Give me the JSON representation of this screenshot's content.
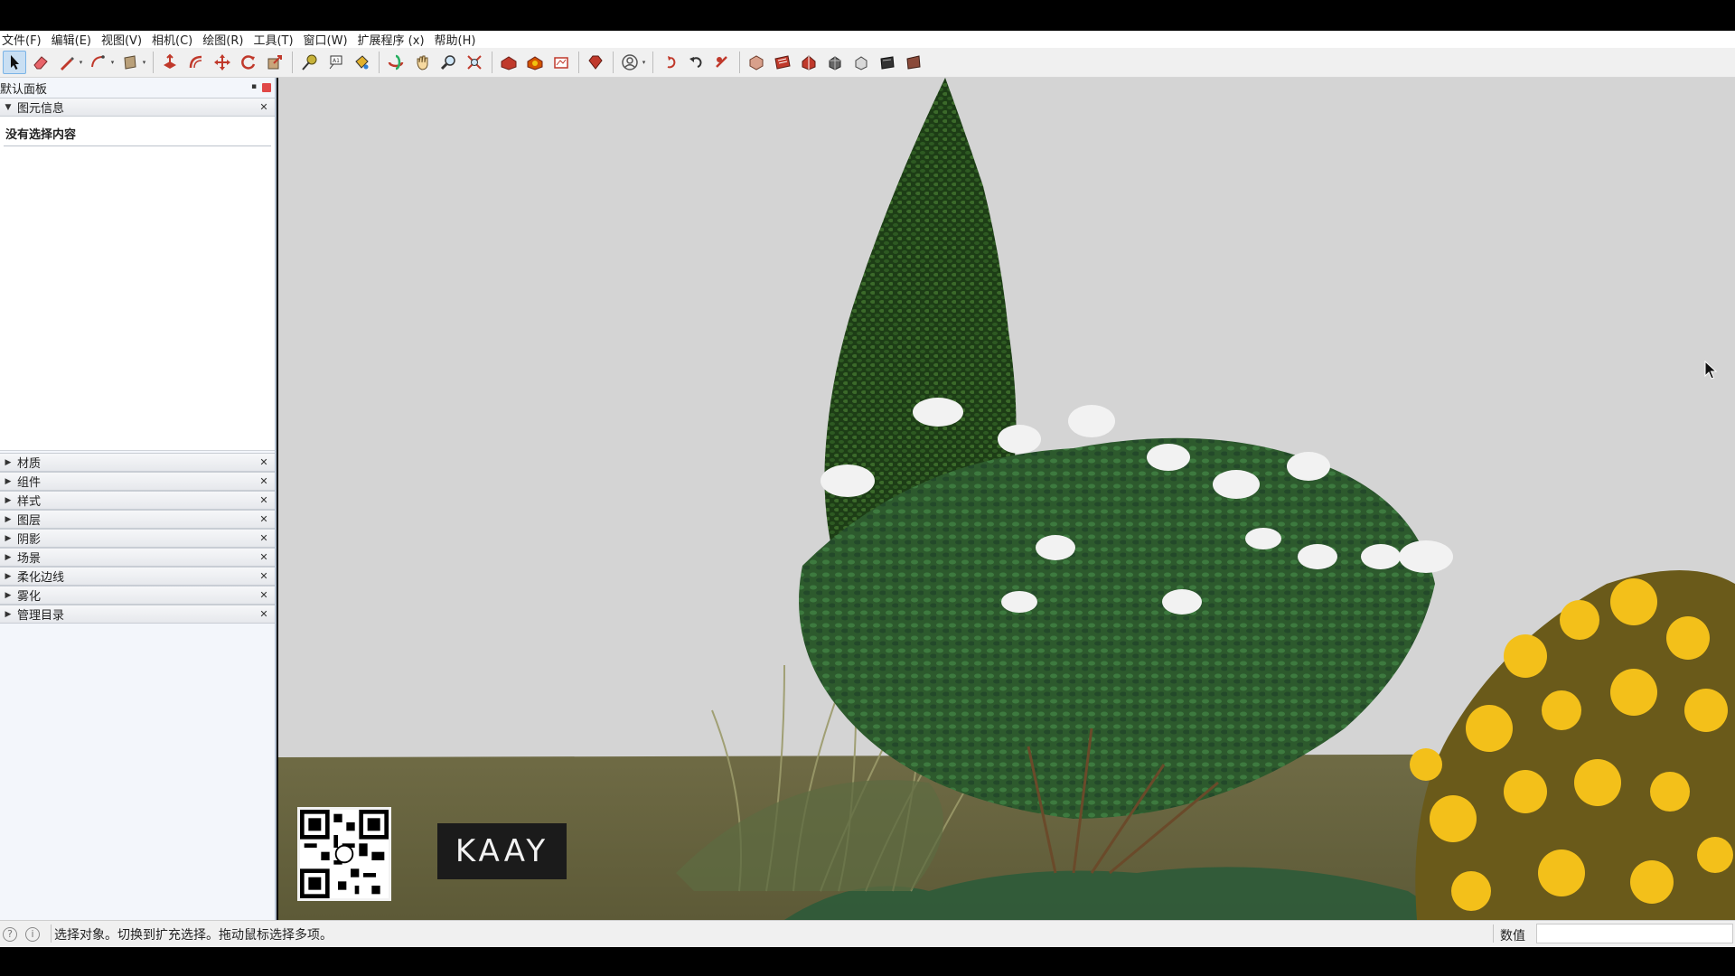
{
  "menu": [
    {
      "label": "文件(F)"
    },
    {
      "label": "编辑(E)"
    },
    {
      "label": "视图(V)"
    },
    {
      "label": "相机(C)"
    },
    {
      "label": "绘图(R)"
    },
    {
      "label": "工具(T)"
    },
    {
      "label": "窗口(W)"
    },
    {
      "label": "扩展程序 (x)"
    },
    {
      "label": "帮助(H)"
    }
  ],
  "toolbar_icons": [
    "select-icon",
    "eraser-icon",
    "pencil-icon",
    "arc-icon",
    "rectangle-icon",
    "push-pull-icon",
    "offset-icon",
    "move-icon",
    "rotate-icon",
    "scale-icon",
    "tape-measure-icon",
    "text-icon",
    "paint-bucket-icon",
    "orbit-icon",
    "pan-icon",
    "zoom-icon",
    "zoom-extents-icon",
    "warehouse-icon",
    "extension-warehouse-icon",
    "layout-icon",
    "ruby-icon",
    "account-icon",
    "undo-icon",
    "redo-icon",
    "back-icon",
    "iso-view-icon",
    "top-view-icon",
    "front-view-icon",
    "right-view-icon",
    "back-view-icon",
    "left-view-icon",
    "bottom-view-icon"
  ],
  "tray": {
    "title": "默认面板",
    "entity_info": {
      "title": "图元信息",
      "empty_text": "没有选择内容"
    },
    "panels": [
      {
        "label": "材质"
      },
      {
        "label": "组件"
      },
      {
        "label": "样式"
      },
      {
        "label": "图层"
      },
      {
        "label": "阴影"
      },
      {
        "label": "场景"
      },
      {
        "label": "柔化边线"
      },
      {
        "label": "雾化"
      },
      {
        "label": "管理目录"
      }
    ]
  },
  "viewport": {
    "brand": "KAAY",
    "sky_color": "#d4d4d4",
    "ground_color": "#6e6a42"
  },
  "statusbar": {
    "text": "选择对象。切换到扩充选择。拖动鼠标选择多项。",
    "measure_label": "数值",
    "measure_value": ""
  }
}
